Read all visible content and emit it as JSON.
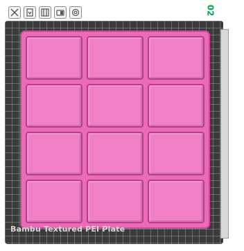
{
  "toolbar": {
    "buttons": [
      {
        "name": "close-icon"
      },
      {
        "name": "auto-orient-icon"
      },
      {
        "name": "arrange-icon"
      },
      {
        "name": "lock-icon"
      },
      {
        "name": "settings-icon"
      }
    ]
  },
  "plate": {
    "number": "02",
    "label": "Bambu Textured PEI Plate"
  },
  "object": {
    "color": "#ea6cb8",
    "rows": 4,
    "cols": 3
  },
  "colors": {
    "bed": "#3a3a3a",
    "plate_number": "#00a651"
  }
}
